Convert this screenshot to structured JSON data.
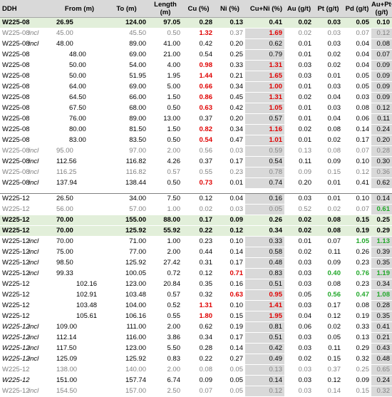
{
  "headers": [
    "DDH",
    "From (m)",
    "To (m)",
    "Length (m)",
    "Cu (%)",
    "Ni (%)",
    "Cu+Ni (%)",
    "Au (g/t)",
    "Pt (g/t)",
    "Pd (g/t)",
    "Au+Pt+Pd (g/t)"
  ],
  "rows": [
    {
      "ddh": "W225-08",
      "incl": "",
      "from": "26.95",
      "to": "124.00",
      "length": "97.05",
      "cu": "0.28",
      "ni": "0.13",
      "cuni": "0.41",
      "au": "0.02",
      "pt": "0.03",
      "pd": "0.05",
      "sum": "0.10",
      "style": "hl",
      "indent": 0
    },
    {
      "ddh": "W225-08",
      "incl": "incl",
      "from": "45.00",
      "to": "45.50",
      "length": "0.50",
      "cu": "1.32",
      "ni": "0.37",
      "cuni": "1.69",
      "au": "0.02",
      "pt": "0.03",
      "pd": "0.07",
      "sum": "0.12",
      "style": "grey",
      "indent": 0,
      "red": [
        "cu",
        "cuni"
      ]
    },
    {
      "ddh": "W225-08",
      "incl": "incl",
      "from": "48.00",
      "to": "89.00",
      "length": "41.00",
      "cu": "0.42",
      "ni": "0.20",
      "cuni": "0.62",
      "au": "0.01",
      "pt": "0.03",
      "pd": "0.04",
      "sum": "0.08",
      "style": "",
      "indent": 0
    },
    {
      "ddh": "W225-08",
      "incl": "",
      "from": "48.00",
      "to": "69.00",
      "length": "21.00",
      "cu": "0.54",
      "ni": "0.25",
      "cuni": "0.79",
      "au": "0.01",
      "pt": "0.02",
      "pd": "0.04",
      "sum": "0.07",
      "style": "",
      "indent": 1
    },
    {
      "ddh": "W225-08",
      "incl": "",
      "from": "50.00",
      "to": "54.00",
      "length": "4.00",
      "cu": "0.98",
      "ni": "0.33",
      "cuni": "1.31",
      "au": "0.03",
      "pt": "0.02",
      "pd": "0.04",
      "sum": "0.09",
      "style": "",
      "indent": 1,
      "red": [
        "cu",
        "cuni"
      ]
    },
    {
      "ddh": "W225-08",
      "incl": "",
      "from": "50.00",
      "to": "51.95",
      "length": "1.95",
      "cu": "1.44",
      "ni": "0.21",
      "cuni": "1.65",
      "au": "0.03",
      "pt": "0.01",
      "pd": "0.05",
      "sum": "0.09",
      "style": "",
      "indent": 1,
      "red": [
        "cu",
        "cuni"
      ]
    },
    {
      "ddh": "W225-08",
      "incl": "",
      "from": "64.00",
      "to": "69.00",
      "length": "5.00",
      "cu": "0.66",
      "ni": "0.34",
      "cuni": "1.00",
      "au": "0.01",
      "pt": "0.03",
      "pd": "0.05",
      "sum": "0.09",
      "style": "",
      "indent": 1,
      "red": [
        "cu",
        "cuni"
      ]
    },
    {
      "ddh": "W225-08",
      "incl": "",
      "from": "64.50",
      "to": "66.00",
      "length": "1.50",
      "cu": "0.86",
      "ni": "0.45",
      "cuni": "1.31",
      "au": "0.02",
      "pt": "0.04",
      "pd": "0.03",
      "sum": "0.09",
      "style": "",
      "indent": 1,
      "red": [
        "cu",
        "cuni"
      ]
    },
    {
      "ddh": "W225-08",
      "incl": "",
      "from": "67.50",
      "to": "68.00",
      "length": "0.50",
      "cu": "0.63",
      "ni": "0.42",
      "cuni": "1.05",
      "au": "0.01",
      "pt": "0.03",
      "pd": "0.08",
      "sum": "0.12",
      "style": "",
      "indent": 1,
      "red": [
        "cu",
        "cuni"
      ]
    },
    {
      "ddh": "W225-08",
      "incl": "",
      "from": "76.00",
      "to": "89.00",
      "length": "13.00",
      "cu": "0.37",
      "ni": "0.20",
      "cuni": "0.57",
      "au": "0.01",
      "pt": "0.04",
      "pd": "0.06",
      "sum": "0.11",
      "style": "",
      "indent": 1
    },
    {
      "ddh": "W225-08",
      "incl": "",
      "from": "80.00",
      "to": "81.50",
      "length": "1.50",
      "cu": "0.82",
      "ni": "0.34",
      "cuni": "1.16",
      "au": "0.02",
      "pt": "0.08",
      "pd": "0.14",
      "sum": "0.24",
      "style": "",
      "indent": 1,
      "red": [
        "cu",
        "cuni"
      ]
    },
    {
      "ddh": "W225-08",
      "incl": "",
      "from": "83.00",
      "to": "83.50",
      "length": "0.50",
      "cu": "0.54",
      "ni": "0.47",
      "cuni": "1.01",
      "au": "0.01",
      "pt": "0.02",
      "pd": "0.17",
      "sum": "0.20",
      "style": "",
      "indent": 1,
      "red": [
        "cu",
        "cuni"
      ]
    },
    {
      "ddh": "W225-08",
      "incl": "incl",
      "from": "95.00",
      "to": "97.00",
      "length": "2.00",
      "cu": "0.56",
      "ni": "0.03",
      "cuni": "0.59",
      "au": "0.13",
      "pt": "0.08",
      "pd": "0.07",
      "sum": "0.28",
      "style": "grey",
      "indent": 0
    },
    {
      "ddh": "W225-08",
      "incl": "incl",
      "from": "112.56",
      "to": "116.82",
      "length": "4.26",
      "cu": "0.37",
      "ni": "0.17",
      "cuni": "0.54",
      "au": "0.11",
      "pt": "0.09",
      "pd": "0.10",
      "sum": "0.30",
      "style": "",
      "indent": 0
    },
    {
      "ddh": "W225-08",
      "incl": "incl",
      "from": "116.25",
      "to": "116.82",
      "length": "0.57",
      "cu": "0.55",
      "ni": "0.23",
      "cuni": "0.78",
      "au": "0.09",
      "pt": "0.15",
      "pd": "0.12",
      "sum": "0.36",
      "style": "grey",
      "indent": 0
    },
    {
      "ddh": "W225-08",
      "incl": "incl",
      "from": "137.94",
      "to": "138.44",
      "length": "0.50",
      "cu": "0.73",
      "ni": "0.01",
      "cuni": "0.74",
      "au": "0.20",
      "pt": "0.01",
      "pd": "0.41",
      "sum": "0.62",
      "style": "",
      "indent": 0,
      "red": [
        "cu"
      ]
    },
    {
      "sep": true
    },
    {
      "ddh": "W225-12",
      "incl": "",
      "from": "26.50",
      "to": "34.00",
      "length": "7.50",
      "cu": "0.12",
      "ni": "0.04",
      "cuni": "0.16",
      "au": "0.03",
      "pt": "0.01",
      "pd": "0.10",
      "sum": "0.14",
      "style": "",
      "indent": 0
    },
    {
      "ddh": "W225-12",
      "incl": "",
      "from": "56.00",
      "to": "57.00",
      "length": "1.00",
      "cu": "0.02",
      "ni": "0.03",
      "cuni": "0.05",
      "au": "0.52",
      "pt": "0.02",
      "pd": "0.07",
      "sum": "0.61",
      "style": "grey",
      "indent": 0,
      "green": [
        "sum"
      ]
    },
    {
      "ddh": "W225-12",
      "incl": "",
      "from": "70.00",
      "to": "155.00",
      "length": "88.00",
      "cu": "0.17",
      "ni": "0.09",
      "cuni": "0.26",
      "au": "0.02",
      "pt": "0.08",
      "pd": "0.15",
      "sum": "0.25",
      "style": "hl",
      "indent": 0
    },
    {
      "ddh": "W225-12",
      "incl": "",
      "from": "70.00",
      "to": "125.92",
      "length": "55.92",
      "cu": "0.22",
      "ni": "0.12",
      "cuni": "0.34",
      "au": "0.02",
      "pt": "0.08",
      "pd": "0.19",
      "sum": "0.29",
      "style": "hl",
      "indent": 0
    },
    {
      "ddh": "W225-12",
      "incl": "incl",
      "from": "70.00",
      "to": "71.00",
      "length": "1.00",
      "cu": "0.23",
      "ni": "0.10",
      "cuni": "0.33",
      "au": "0.01",
      "pt": "0.07",
      "pd": "1.05",
      "sum": "1.13",
      "style": "",
      "indent": 0,
      "green": [
        "pd",
        "sum"
      ]
    },
    {
      "ddh": "W225-12",
      "incl": "incl",
      "from": "75.00",
      "to": "77.00",
      "length": "2.00",
      "cu": "0.44",
      "ni": "0.14",
      "cuni": "0.58",
      "au": "0.02",
      "pt": "0.11",
      "pd": "0.26",
      "sum": "0.39",
      "style": "",
      "indent": 0
    },
    {
      "ddh": "W225-12",
      "incl": "incl",
      "from": "98.50",
      "to": "125.92",
      "length": "27.42",
      "cu": "0.31",
      "ni": "0.17",
      "cuni": "0.48",
      "au": "0.03",
      "pt": "0.09",
      "pd": "0.23",
      "sum": "0.35",
      "style": "",
      "indent": 0
    },
    {
      "ddh": "W225-12",
      "incl": "incl",
      "from": "99.33",
      "to": "100.05",
      "length": "0.72",
      "cu": "0.12",
      "ni": "0.71",
      "cuni": "0.83",
      "au": "0.03",
      "pt": "0.40",
      "pd": "0.76",
      "sum": "1.19",
      "style": "",
      "indent": 0,
      "red": [
        "ni"
      ],
      "green": [
        "pt",
        "pd",
        "sum"
      ]
    },
    {
      "ddh": "W225-12",
      "incl": "",
      "from": "102.16",
      "to": "123.00",
      "length": "20.84",
      "cu": "0.35",
      "ni": "0.16",
      "cuni": "0.51",
      "au": "0.03",
      "pt": "0.08",
      "pd": "0.23",
      "sum": "0.34",
      "style": "",
      "indent": 2
    },
    {
      "ddh": "W225-12",
      "incl": "",
      "from": "102.91",
      "to": "103.48",
      "length": "0.57",
      "cu": "0.32",
      "ni": "0.63",
      "cuni": "0.95",
      "au": "0.05",
      "pt": "0.56",
      "pd": "0.47",
      "sum": "1.08",
      "style": "",
      "indent": 2,
      "red": [
        "ni",
        "cuni"
      ],
      "green": [
        "pt",
        "pd",
        "sum"
      ]
    },
    {
      "ddh": "W225-12",
      "incl": "",
      "from": "103.48",
      "to": "104.00",
      "length": "0.52",
      "cu": "1.31",
      "ni": "0.10",
      "cuni": "1.41",
      "au": "0.03",
      "pt": "0.17",
      "pd": "0.08",
      "sum": "0.28",
      "style": "",
      "indent": 2,
      "red": [
        "cu",
        "cuni"
      ]
    },
    {
      "ddh": "W225-12",
      "incl": "",
      "from": "105.61",
      "to": "106.16",
      "length": "0.55",
      "cu": "1.80",
      "ni": "0.15",
      "cuni": "1.95",
      "au": "0.04",
      "pt": "0.12",
      "pd": "0.19",
      "sum": "0.35",
      "style": "",
      "indent": 2,
      "red": [
        "cu",
        "cuni"
      ]
    },
    {
      "ddh": "W225-12",
      "incl": "incl",
      "from": "109.00",
      "to": "111.00",
      "length": "2.00",
      "cu": "0.62",
      "ni": "0.19",
      "cuni": "0.81",
      "au": "0.06",
      "pt": "0.02",
      "pd": "0.33",
      "sum": "0.41",
      "style": "itl",
      "indent": 0
    },
    {
      "ddh": "W225-12",
      "incl": "incl",
      "from": "112.14",
      "to": "116.00",
      "length": "3.86",
      "cu": "0.34",
      "ni": "0.17",
      "cuni": "0.51",
      "au": "0.03",
      "pt": "0.05",
      "pd": "0.13",
      "sum": "0.21",
      "style": "itl",
      "indent": 0
    },
    {
      "ddh": "W225-12",
      "incl": "incl",
      "from": "117.50",
      "to": "123.00",
      "length": "5.50",
      "cu": "0.28",
      "ni": "0.14",
      "cuni": "0.42",
      "au": "0.03",
      "pt": "0.11",
      "pd": "0.29",
      "sum": "0.43",
      "style": "itl",
      "indent": 0
    },
    {
      "ddh": "W225-12",
      "incl": "incl",
      "from": "125.09",
      "to": "125.92",
      "length": "0.83",
      "cu": "0.22",
      "ni": "0.27",
      "cuni": "0.49",
      "au": "0.02",
      "pt": "0.15",
      "pd": "0.32",
      "sum": "0.48",
      "style": "itl",
      "indent": 0
    },
    {
      "ddh": "W225-12",
      "incl": "",
      "from": "138.00",
      "to": "140.00",
      "length": "2.00",
      "cu": "0.08",
      "ni": "0.05",
      "cuni": "0.13",
      "au": "0.03",
      "pt": "0.37",
      "pd": "0.25",
      "sum": "0.65",
      "style": "grey",
      "indent": 0
    },
    {
      "ddh": "W225-12",
      "incl": "",
      "from": "151.00",
      "to": "157.74",
      "length": "6.74",
      "cu": "0.09",
      "ni": "0.05",
      "cuni": "0.14",
      "au": "0.03",
      "pt": "0.12",
      "pd": "0.09",
      "sum": "0.24",
      "style": "itl",
      "indent": 0
    },
    {
      "ddh": "W225-12",
      "incl": "incl",
      "from": "154.50",
      "to": "157.00",
      "length": "2.50",
      "cu": "0.07",
      "ni": "0.05",
      "cuni": "0.12",
      "au": "0.03",
      "pt": "0.14",
      "pd": "0.15",
      "sum": "0.32",
      "style": "grey",
      "indent": 0
    }
  ]
}
